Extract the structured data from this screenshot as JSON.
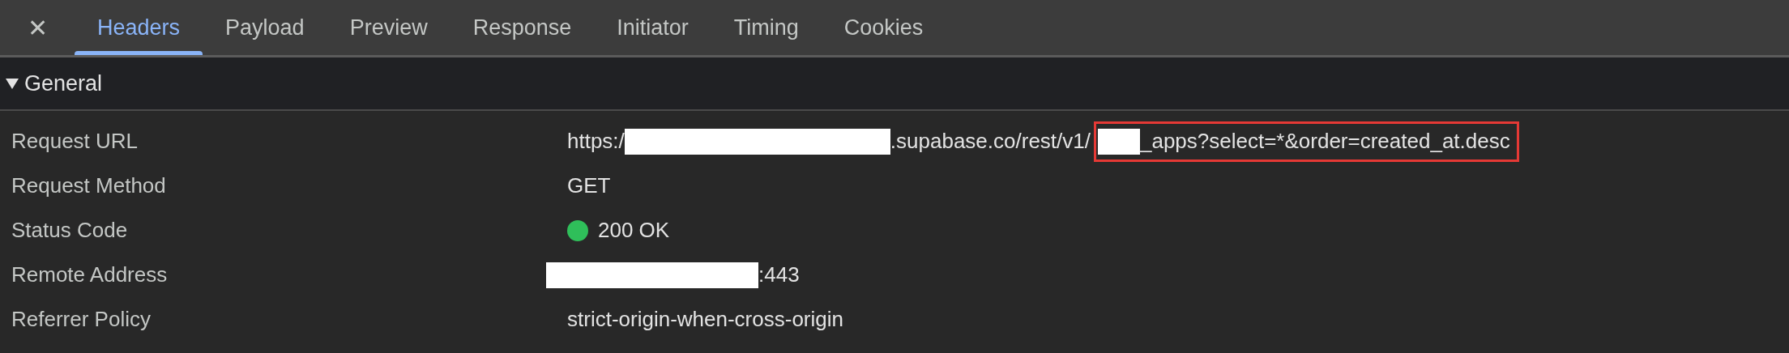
{
  "close_button": "✕",
  "tabs": [
    {
      "label": "Headers",
      "selected": true
    },
    {
      "label": "Payload",
      "selected": false
    },
    {
      "label": "Preview",
      "selected": false
    },
    {
      "label": "Response",
      "selected": false
    },
    {
      "label": "Initiator",
      "selected": false
    },
    {
      "label": "Timing",
      "selected": false
    },
    {
      "label": "Cookies",
      "selected": false
    }
  ],
  "section": {
    "title": "General",
    "expanded": true
  },
  "rows": [
    {
      "label": "Request URL",
      "value": [
        {
          "kind": "text",
          "text": "https:/"
        },
        {
          "kind": "redaction"
        },
        {
          "kind": "text",
          "text": ".supabase.co/rest/v1/"
        },
        {
          "kind": "highlight",
          "children": [
            {
              "kind": "redaction"
            },
            {
              "kind": "text",
              "text": "_apps?select=*&order=created_at.desc"
            }
          ]
        }
      ]
    },
    {
      "label": "Request Method",
      "value": [
        {
          "kind": "text",
          "text": "GET"
        }
      ]
    },
    {
      "label": "Status Code",
      "value": [
        {
          "kind": "status",
          "color": "#2fbf5a"
        },
        {
          "kind": "text",
          "text": "200 OK"
        }
      ]
    },
    {
      "label": "Remote Address",
      "value": [
        {
          "kind": "redaction"
        },
        {
          "kind": "text",
          "text": ":443"
        }
      ]
    },
    {
      "label": "Referrer Policy",
      "value": [
        {
          "kind": "text",
          "text": "strict-origin-when-cross-origin"
        }
      ]
    }
  ]
}
